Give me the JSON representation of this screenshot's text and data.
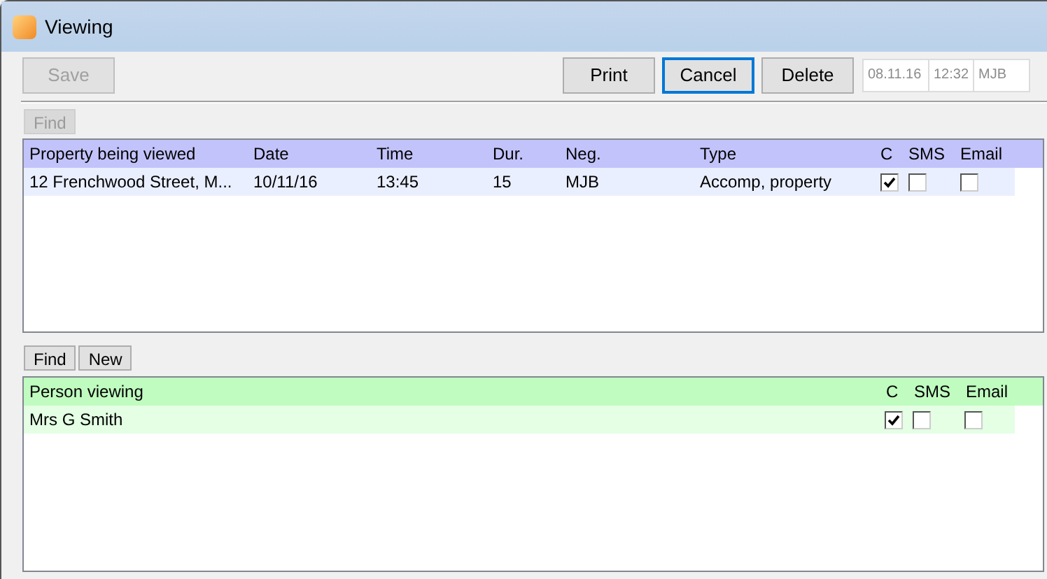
{
  "window": {
    "title": "Viewing"
  },
  "toolbar": {
    "buttons": [
      {
        "label": "Save",
        "disabled": true,
        "focused": false
      },
      {
        "label": "Print",
        "disabled": false,
        "focused": false
      },
      {
        "label": "Cancel",
        "disabled": false,
        "focused": true
      },
      {
        "label": "Delete",
        "disabled": false,
        "focused": false
      }
    ],
    "fields": [
      {
        "value": "08.11.16"
      },
      {
        "value": "12:32"
      },
      {
        "value": "MJB"
      }
    ]
  },
  "properties": {
    "buttons": [
      {
        "label": "Find",
        "disabled": true
      }
    ],
    "columns": [
      "Property being viewed",
      "Date",
      "Time",
      "Dur.",
      "Neg.",
      "Type",
      "C",
      "SMS",
      "Email"
    ],
    "rows": [
      {
        "cells": [
          "12 Frenchwood Street, M...",
          "10/11/16",
          "13:45",
          "15",
          "MJB",
          "Accomp, property"
        ],
        "c": true,
        "sms": false,
        "email": false
      }
    ]
  },
  "people": {
    "buttons": [
      {
        "label": "Find",
        "disabled": false
      },
      {
        "label": "New",
        "disabled": false
      }
    ],
    "columns": [
      "Person viewing",
      "C",
      "SMS",
      "Email"
    ],
    "rows": [
      {
        "cells": [
          "Mrs G Smith"
        ],
        "c": true,
        "sms": false,
        "email": false
      }
    ]
  }
}
